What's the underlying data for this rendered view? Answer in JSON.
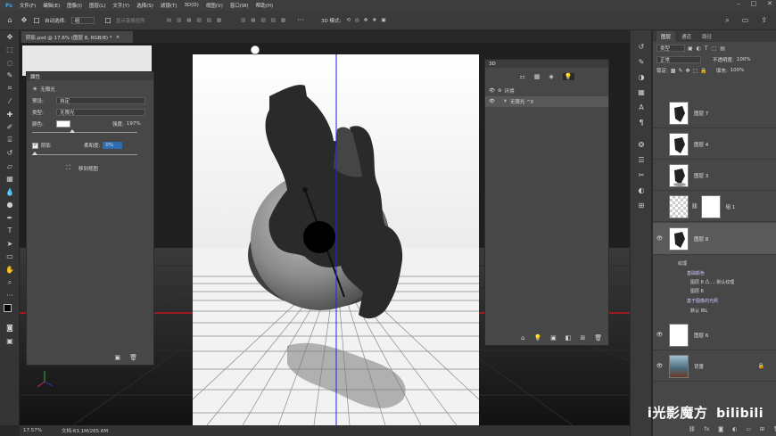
{
  "menu": [
    "文件(F)",
    "编辑(E)",
    "图像(I)",
    "图层(L)",
    "文字(Y)",
    "选择(S)",
    "滤镜(T)",
    "3D(D)",
    "视图(V)",
    "窗口(W)",
    "帮助(H)"
  ],
  "options": {
    "auto_select_label": "自动选择:",
    "auto_select_value": "组",
    "show_transform": "显示变换控件",
    "mode_3d": "3D 模式:"
  },
  "document_tab": "阴影.psd @ 17.6% (图层 8, RGB/8) *",
  "properties": {
    "tab": "属性",
    "light_type_title": "无限光",
    "preset_label": "预设:",
    "preset_value": "自定",
    "type_label": "类型:",
    "type_value": "无限光",
    "color_label": "颜色:",
    "intensity_label": "强度:",
    "intensity_value": "197%",
    "shadow_label": "阴影",
    "softness_label": "柔和度:",
    "softness_value": "0%",
    "move_to_view": "移到视图",
    "intensity_level": 0.38,
    "softness_level": 0.0
  },
  "panel3d": {
    "tab": "3D",
    "env_label": "环境",
    "light_label": "无限光 ^0"
  },
  "status": {
    "zoom": "17.57%",
    "doc": "文档:63.1M/265.6M"
  },
  "layers_panel": {
    "tabs": [
      "图层",
      "通道",
      "路径"
    ],
    "kind_label": "类型",
    "blend_mode": "正常",
    "opacity_label": "不透明度:",
    "opacity_value": "100%",
    "lock_label": "锁定:",
    "fill_label": "填充:",
    "fill_value": "100%",
    "layers": [
      {
        "name": "图层 7",
        "visible": false
      },
      {
        "name": "图层 4",
        "visible": false
      },
      {
        "name": "图层 3",
        "visible": false
      },
      {
        "name": "组 1",
        "visible": false
      },
      {
        "name": "图层 8",
        "visible": true
      },
      {
        "name": "图层 6",
        "visible": true
      },
      {
        "name": "背景",
        "visible": true
      }
    ],
    "sub_items": [
      "纹理",
      "基础颜色",
      "图层 8 凸...: 默认纹理",
      "图层 8",
      "基于图像的光照",
      "默认 IBL"
    ]
  },
  "watermark": "i光影魔方",
  "colors": {
    "accent": "#2d6db0",
    "red_line": "#c8141e",
    "guide_blue": "#2222dd"
  }
}
